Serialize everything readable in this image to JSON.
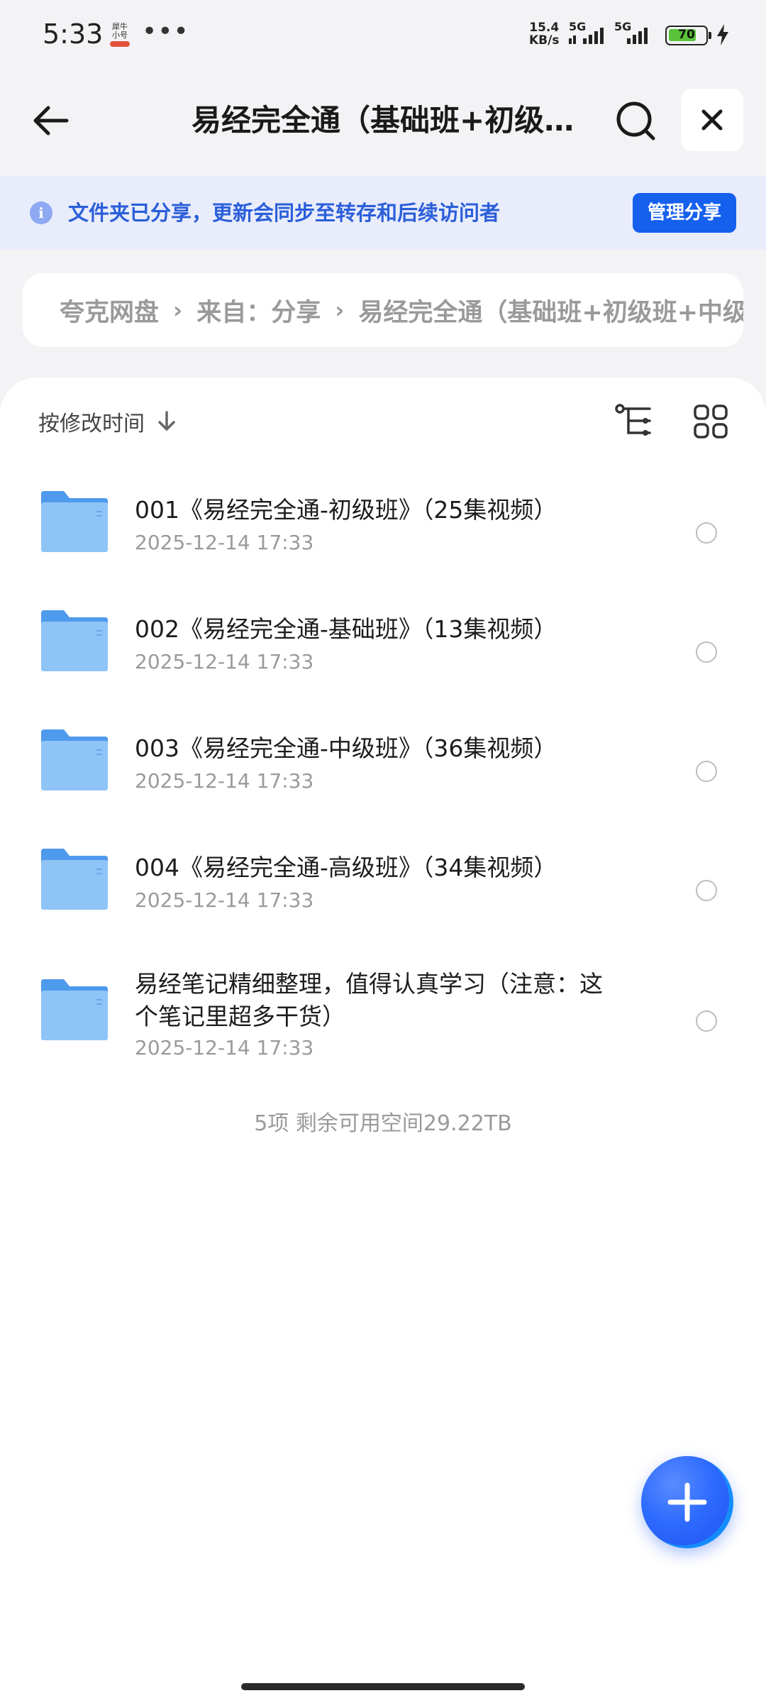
{
  "status_bar": {
    "time": "5:33",
    "app_icon_text": "犀牛小号",
    "more": "•••",
    "speed_value": "15.4",
    "speed_unit": "KB/s",
    "network1": "5G",
    "network2": "5G",
    "battery": "70",
    "icons": [
      "signal-icon",
      "battery-icon",
      "charging-bolt-icon"
    ]
  },
  "header": {
    "title": "易经完全通（基础班+初级班+中级班+高级班）",
    "icons": [
      "back-arrow-icon",
      "search-icon",
      "close-icon"
    ]
  },
  "notice": {
    "text": "文件夹已分享，更新会同步至转存和后续访问者",
    "button": "管理分享",
    "icon": "info-icon"
  },
  "breadcrumb": {
    "items": [
      "夸克网盘",
      "来自：分享",
      "易经完全通（基础班+初级班+中级班+高级班）"
    ]
  },
  "toolbar": {
    "sort_label": "按修改时间",
    "icons": [
      "sort-down-arrow-icon",
      "tree-view-icon",
      "grid-view-icon"
    ]
  },
  "files": [
    {
      "name": "001《易经完全通-初级班》（25集视频）",
      "date": "2025-12-14 17:33"
    },
    {
      "name": "002《易经完全通-基础班》（13集视频）",
      "date": "2025-12-14 17:33"
    },
    {
      "name": "003《易经完全通-中级班》（36集视频）",
      "date": "2025-12-14 17:33"
    },
    {
      "name": "004《易经完全通-高级班》（34集视频）",
      "date": "2025-12-14 17:33"
    },
    {
      "name": "易经笔记精细整理，值得认真学习（注意：这个笔记里超多干货）",
      "date": "2025-12-14 17:33"
    }
  ],
  "footer": {
    "summary": "5项 剩余可用空间29.22TB"
  },
  "colors": {
    "accent": "#1660ee",
    "notice_bg": "#e8ecfb",
    "notice_text": "#2b5fd9",
    "folder": "#5aa8f0"
  }
}
